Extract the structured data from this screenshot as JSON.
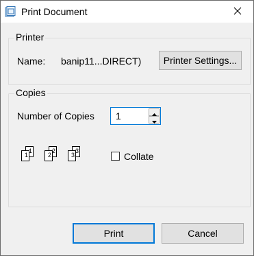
{
  "window": {
    "title": "Print Document",
    "icon": "print-document-app-icon"
  },
  "printer_group": {
    "legend": "Printer",
    "name_label": "Name:",
    "name_value": "banip11...DIRECT)",
    "settings_button": "Printer Settings..."
  },
  "copies_group": {
    "legend": "Copies",
    "number_label": "Number of Copies",
    "number_value": "1",
    "collate_label": "Collate",
    "collate_checked": false,
    "collate_pages": [
      "1",
      "1",
      "2",
      "2",
      "3",
      "3"
    ]
  },
  "buttons": {
    "print": "Print",
    "cancel": "Cancel"
  },
  "colors": {
    "accent": "#0078d7",
    "dialog_bg": "#f0f0f0",
    "button_bg": "#e1e1e1"
  }
}
